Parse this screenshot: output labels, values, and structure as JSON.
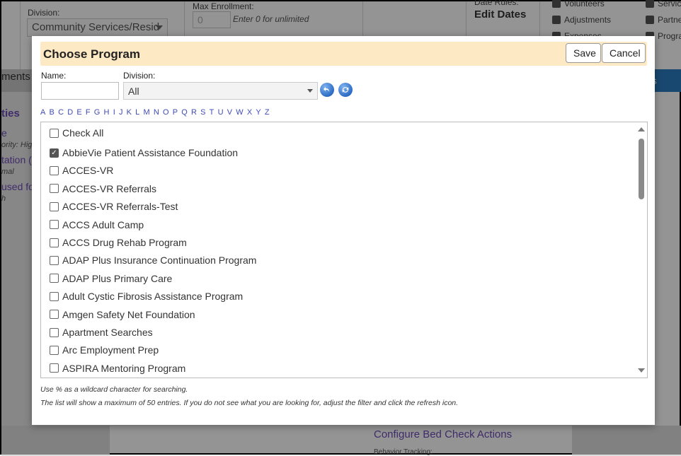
{
  "background": {
    "division_label": "Division:",
    "division_value": "Community Services/Resid",
    "max_enrollment_label": "Max Enrollment:",
    "max_enrollment_value": "0",
    "max_enrollment_hint": "Enter 0 for unlimited",
    "date_rules_label": "Date Rules:",
    "edit_dates": "Edit Dates",
    "checks_col1": [
      "Volunteers",
      "Adjustments",
      "Expenses"
    ],
    "checks_col2": [
      "Service",
      "Partne",
      "Progra"
    ],
    "tab_left": "ments (",
    "tab_right": "ns",
    "left_links": [
      "ties",
      "e",
      "tation (",
      "used fo"
    ],
    "left_small": [
      "ority: Hig",
      "mal",
      "h"
    ],
    "bottom_link": "Configure Bed Check Actions",
    "bottom_small": "Behavior Tracking:"
  },
  "modal": {
    "title": "Choose Program",
    "save_label": "Save",
    "cancel_label": "Cancel",
    "name_label": "Name:",
    "name_value": "",
    "division_label": "Division:",
    "division_value": "All",
    "letters": [
      "A",
      "B",
      "C",
      "D",
      "E",
      "F",
      "G",
      "H",
      "I",
      "J",
      "K",
      "L",
      "M",
      "N",
      "O",
      "P",
      "Q",
      "R",
      "S",
      "T",
      "U",
      "V",
      "W",
      "X",
      "Y",
      "Z"
    ],
    "check_all_label": "Check All",
    "items": [
      {
        "label": "AbbieVie Patient Assistance Foundation",
        "checked": true
      },
      {
        "label": "ACCES-VR",
        "checked": false
      },
      {
        "label": "ACCES-VR Referrals",
        "checked": false
      },
      {
        "label": "ACCES-VR Referrals-Test",
        "checked": false
      },
      {
        "label": "ACCS Adult Camp",
        "checked": false
      },
      {
        "label": "ACCS Drug Rehab Program",
        "checked": false
      },
      {
        "label": "ADAP Plus Insurance Continuation Program",
        "checked": false
      },
      {
        "label": "ADAP Plus Primary Care",
        "checked": false
      },
      {
        "label": "Adult Cystic Fibrosis Assistance Program",
        "checked": false
      },
      {
        "label": "Amgen Safety Net Foundation",
        "checked": false
      },
      {
        "label": "Apartment Searches",
        "checked": false
      },
      {
        "label": "Arc Employment Prep",
        "checked": false
      },
      {
        "label": "ASPIRA Mentoring Program",
        "checked": false
      }
    ],
    "note1": "Use % as a wildcard character for searching.",
    "note2": "The list will show a maximum of 50 entries. If you do not see what you are looking for, adjust the filter and click the refresh icon."
  },
  "icons": {
    "back": "back-icon",
    "refresh": "refresh-icon"
  }
}
